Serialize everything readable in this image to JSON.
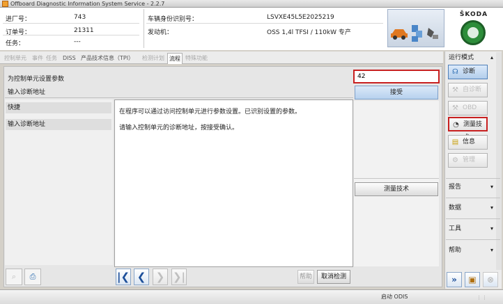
{
  "window": {
    "title": "Offboard Diagnostic Information System Service - 2.2.7"
  },
  "header": {
    "workshop_label": "进厂号：",
    "workshop_value": "743",
    "order_label": "订单号：",
    "order_value": "21311",
    "task_label": "任务：",
    "task_value": "---",
    "vin_label": "车辆身份识别号：",
    "vin_value": "LSVXE45L5E2025219",
    "engine_label": "发动机：",
    "engine_value": "OSS 1,4l TFSI / 110kW 专产",
    "brand": "ŠKODA"
  },
  "tabs": [
    {
      "label": "控制单元",
      "active": false
    },
    {
      "label": "事件",
      "active": false
    },
    {
      "label": "任务",
      "active": false
    },
    {
      "label": "DISS",
      "active": false
    },
    {
      "label": "产品技术信息（TPI）",
      "active": false
    },
    {
      "label": "检测计划",
      "active": false
    },
    {
      "label": "流程",
      "active": true
    },
    {
      "label": "特殊功能",
      "active": false
    }
  ],
  "main": {
    "step_title": "为控制单元设置参数",
    "step_subtitle": "输入诊断地址",
    "input_value": "42",
    "accept_label": "接受",
    "left_items": [
      "快捷",
      "输入诊断地址"
    ],
    "description": [
      "在程序可以通过访问控制单元进行参数设置。已识别设置的参数。",
      "请输入控制单元的诊断地址，按接受确认。"
    ],
    "measure_label": "测量技术",
    "help_label": "帮助",
    "cancel_label": "取消检测"
  },
  "sidebar": {
    "mode_header": "运行模式",
    "modes": [
      {
        "label": "诊断",
        "icon": "stethoscope-icon",
        "enabled": true
      },
      {
        "label": "自诊断",
        "icon": "self-diagnosis-icon",
        "enabled": false
      },
      {
        "label": "OBD",
        "icon": "obd-icon",
        "enabled": false
      },
      {
        "label": "测量技术",
        "icon": "gauge-icon",
        "enabled": true
      },
      {
        "label": "信息",
        "icon": "info-book-icon",
        "enabled": true
      },
      {
        "label": "管理",
        "icon": "admin-icon",
        "enabled": false
      }
    ],
    "menus": [
      "报告",
      "数据",
      "工具",
      "帮助"
    ]
  },
  "status": {
    "text": "启动 ODIS"
  },
  "colors": {
    "accent": "#c82020",
    "brand_green": "#2d8d3a",
    "selected_blue": "#b2cdeb"
  }
}
